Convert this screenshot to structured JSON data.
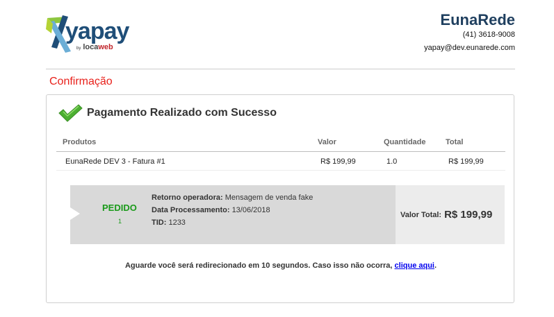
{
  "brand": {
    "logo_text": "yapay",
    "logo_by": "by",
    "logo_sub_a": "loca",
    "logo_sub_b": "web"
  },
  "company": {
    "name": "EunaRede",
    "phone": "(41) 3618-9008",
    "email": "yapay@dev.eunarede.com"
  },
  "page": {
    "section_title": "Confirmação",
    "success_title": "Pagamento Realizado com Sucesso"
  },
  "table": {
    "headers": [
      "Produtos",
      "Valor",
      "Quantidade",
      "Total"
    ],
    "rows": [
      [
        "EunaRede DEV 3 - Fatura #1",
        "R$ 199,99",
        "1.0",
        "R$ 199,99"
      ]
    ]
  },
  "status": {
    "label": "PEDIDO",
    "number": "1",
    "retorno_label": "Retorno operadora:",
    "retorno_value": "Mensagem de venda fake",
    "data_label": "Data Processamento:",
    "data_value": "13/06/2018",
    "tid_label": "TID:",
    "tid_value": "1233"
  },
  "total": {
    "label": "Valor Total:",
    "value": "R$ 199,99"
  },
  "redirect": {
    "text": "Aguarde você será redirecionado em 10 segundos. Caso isso não ocorra,",
    "link": "clique aqui",
    "suffix": "."
  },
  "colors": {
    "title_red": "#e8201a",
    "company_blue": "#1f3f5f",
    "status_green": "#1a9a1a",
    "check_green": "#4caf32"
  },
  "icons": {
    "logo": "yapay-logo-icon",
    "check": "check-icon"
  }
}
